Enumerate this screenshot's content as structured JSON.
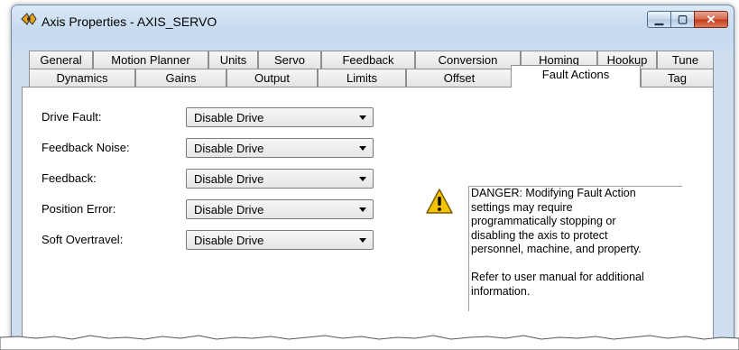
{
  "window": {
    "title": "Axis Properties - AXIS_SERVO",
    "buttons": {
      "minimize": "▁",
      "maximize": "▢",
      "close": "✕"
    }
  },
  "tabs_row1": [
    "General",
    "Motion Planner",
    "Units",
    "Servo",
    "Feedback",
    "Conversion",
    "Homing",
    "Hookup",
    "Tune"
  ],
  "tabs_row2": [
    "Dynamics",
    "Gains",
    "Output",
    "Limits",
    "Offset",
    "Fault Actions",
    "Tag"
  ],
  "active_tab": "Fault Actions",
  "fault_actions": [
    {
      "label": "Drive Fault:",
      "value": "Disable Drive"
    },
    {
      "label": "Feedback Noise:",
      "value": "Disable Drive"
    },
    {
      "label": "Feedback:",
      "value": "Disable Drive"
    },
    {
      "label": "Position Error:",
      "value": "Disable Drive"
    },
    {
      "label": "Soft Overtravel:",
      "value": "Disable Drive"
    }
  ],
  "warning": {
    "icon": "warning-icon",
    "text": "DANGER: Modifying Fault Action\nsettings may require\nprogrammatically stopping or\ndisabling the axis to protect\npersonnel, machine, and property.\n\nRefer to user manual for additional\ninformation."
  },
  "colors": {
    "titlebar": "#c5d9ef",
    "close_button": "#c2391b",
    "warning_yellow": "#f5c400"
  }
}
